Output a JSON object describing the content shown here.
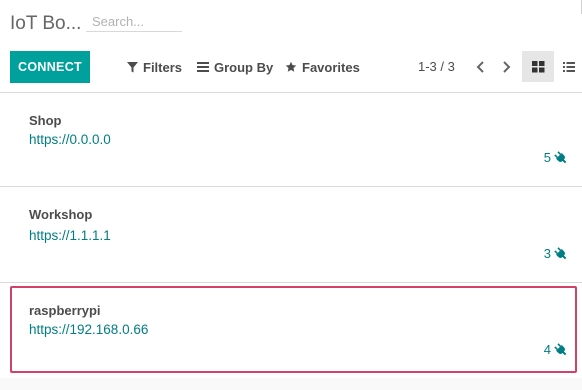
{
  "header": {
    "breadcrumb": "IoT Bo...",
    "search_placeholder": "Search..."
  },
  "toolbar": {
    "connect_label": "CONNECT",
    "filters_label": "Filters",
    "groupby_label": "Group By",
    "favorites_label": "Favorites",
    "pager": "1-3 / 3",
    "active_view": "kanban",
    "icons": [
      "filter-icon",
      "bars-icon",
      "star-icon",
      "chevron-left-icon",
      "chevron-right-icon",
      "kanban-grid-icon",
      "list-icon"
    ]
  },
  "boxes": [
    {
      "name": "Shop",
      "url": "https://0.0.0.0",
      "device_count": "5"
    },
    {
      "name": "Workshop",
      "url": "https://1.1.1.1",
      "device_count": "3"
    },
    {
      "name": "raspberrypi",
      "url": "https://192.168.0.66",
      "device_count": "4"
    }
  ],
  "colors": {
    "accent": "#00a09d",
    "link": "#017e84",
    "highlight_border": "#d14266"
  }
}
